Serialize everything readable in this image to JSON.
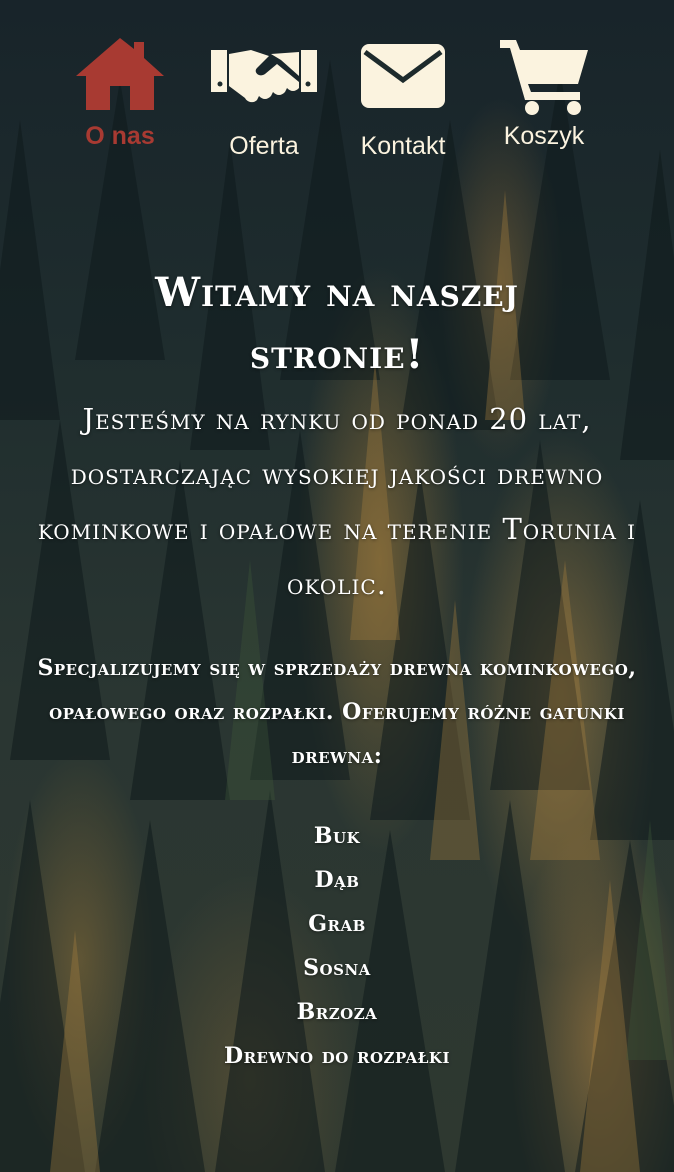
{
  "colors": {
    "accent": "#a83a32",
    "nav_icon": "#fbf3df",
    "text": "#ffffff"
  },
  "nav": {
    "items": [
      {
        "label": "O nas",
        "icon": "house-icon",
        "active": true
      },
      {
        "label": "Oferta",
        "icon": "handshake-icon",
        "active": false
      },
      {
        "label": "Kontakt",
        "icon": "envelope-icon",
        "active": false
      },
      {
        "label": "Koszyk",
        "icon": "cart-icon",
        "active": false
      }
    ]
  },
  "main": {
    "title": "Witamy na naszej stronie!",
    "intro": "Jesteśmy na rynku od ponad 20 lat, dostarczając wysokiej jakości drewno kominkowe i opałowe na terenie Torunia i okolic.",
    "specialization": "Specjalizujemy się w sprzedaży drewna kominkowego, opałowego oraz rozpałki. Oferujemy różne gatunki drewna:",
    "wood_types": [
      "Buk",
      "Dąb",
      "Grab",
      "Sosna",
      "Brzoza",
      "Drewno do rozpałki"
    ]
  }
}
